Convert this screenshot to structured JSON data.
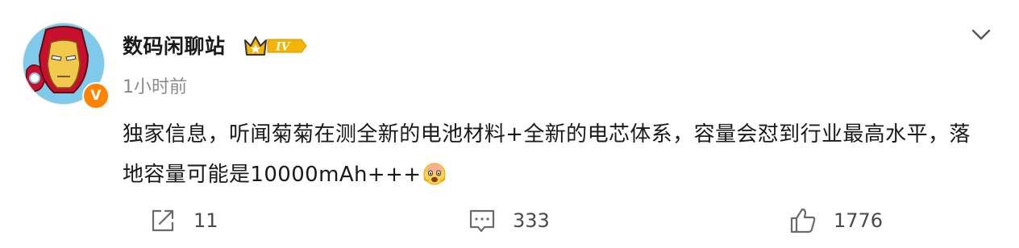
{
  "post": {
    "author": {
      "name": "数码闲聊站",
      "level_badge": "IV",
      "verified_mark": "V",
      "avatar": "iron-man-cartoon-avatar"
    },
    "time": "1小时前",
    "text": "独家信息，听闻菊菊在测全新的电池材料+全新的电芯体系，容量会怼到行业最高水平，落地容量可能是10000mAh+++",
    "emoji": "shocked-face-emoji",
    "more_icon": "chevron-down-icon"
  },
  "actions": {
    "repost": {
      "icon": "share-icon",
      "count": "11"
    },
    "comment": {
      "icon": "comment-icon",
      "count": "333"
    },
    "like": {
      "icon": "thumbs-up-icon",
      "count": "1776"
    }
  },
  "colors": {
    "accent_orange": "#ff8200",
    "badge_gold": "#f5b400",
    "text_primary": "#1a1a1a",
    "text_secondary": "#8a8a8a"
  }
}
